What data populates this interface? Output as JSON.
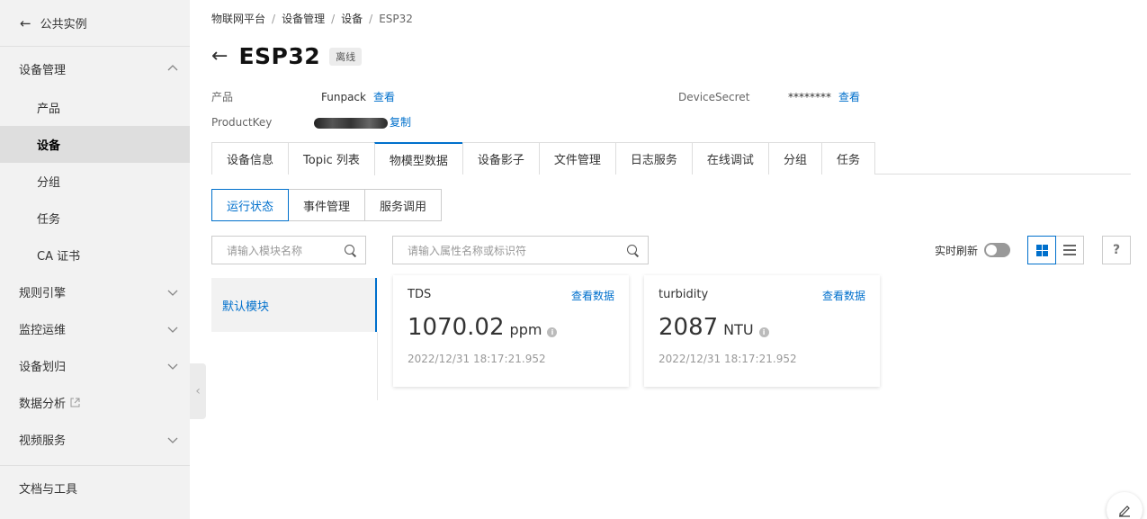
{
  "sidebar": {
    "back_label": "公共实例",
    "groups": [
      {
        "label": "设备管理",
        "expanded": true,
        "items": [
          "产品",
          "设备",
          "分组",
          "任务",
          "CA 证书"
        ],
        "active": "设备"
      },
      {
        "label": "规则引擎"
      },
      {
        "label": "监控运维"
      },
      {
        "label": "设备划归"
      },
      {
        "label": "数据分析"
      },
      {
        "label": "视频服务"
      },
      {
        "label": "文档与工具"
      }
    ]
  },
  "breadcrumb": [
    "物联网平台",
    "设备管理",
    "设备",
    "ESP32"
  ],
  "header": {
    "title": "ESP32",
    "status": "离线"
  },
  "info": {
    "product_label": "产品",
    "product_value": "Funpack",
    "view_link": "查看",
    "productkey_label": "ProductKey",
    "copy_link": "复制",
    "devicesecret_label": "DeviceSecret",
    "devicesecret_value": "********",
    "devicesecret_link": "查看"
  },
  "tabs": [
    "设备信息",
    "Topic 列表",
    "物模型数据",
    "设备影子",
    "文件管理",
    "日志服务",
    "在线调试",
    "分组",
    "任务"
  ],
  "active_tab": "物模型数据",
  "subtabs": [
    "运行状态",
    "事件管理",
    "服务调用"
  ],
  "active_subtab": "运行状态",
  "module_search": {
    "placeholder": "请输入模块名称"
  },
  "prop_search": {
    "placeholder": "请输入属性名称或标识符"
  },
  "modules": [
    "默认模块"
  ],
  "toolbar": {
    "realtime_label": "实时刷新",
    "realtime_on": false,
    "help": "?"
  },
  "cards": [
    {
      "name": "TDS",
      "link": "查看数据",
      "value": "1070.02",
      "unit": "ppm",
      "time": "2022/12/31 18:17:21.952"
    },
    {
      "name": "turbidity",
      "link": "查看数据",
      "value": "2087",
      "unit": "NTU",
      "time": "2022/12/31 18:17:21.952"
    }
  ],
  "colors": {
    "accent": "#0070cc",
    "sidebar_bg": "#f2f2f2"
  }
}
